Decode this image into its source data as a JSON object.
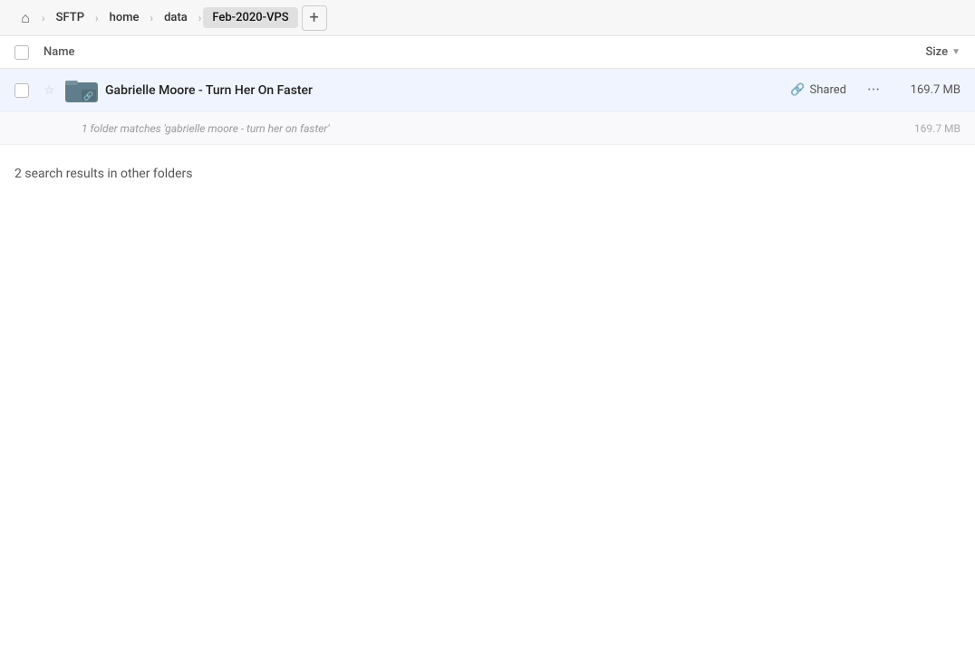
{
  "breadcrumb": {
    "home_icon": "⌂",
    "items": [
      {
        "label": "SFTP",
        "active": false
      },
      {
        "label": "home",
        "active": false
      },
      {
        "label": "data",
        "active": false
      },
      {
        "label": "Feb-2020-VPS",
        "active": true
      }
    ],
    "add_label": "+"
  },
  "table": {
    "col_name": "Name",
    "col_size": "Size",
    "sort_icon": "▼"
  },
  "file_row": {
    "name": "Gabrielle Moore - Turn Her On Faster",
    "shared_label": "Shared",
    "size": "169.7 MB",
    "more_icon": "···",
    "star_icon": "☆",
    "link_icon": "🔗"
  },
  "match_row": {
    "text": "1 folder matches 'gabrielle moore - turn her on faster'",
    "size": "169.7 MB"
  },
  "other_folders": {
    "label": "2 search results in other folders"
  }
}
